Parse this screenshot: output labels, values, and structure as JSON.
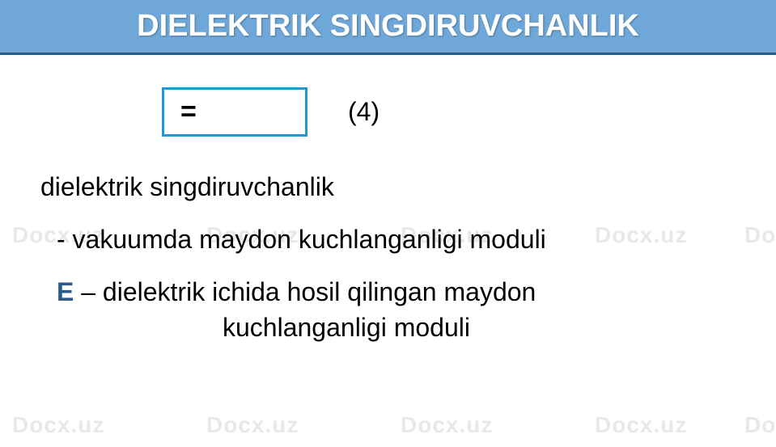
{
  "header": {
    "title": "DIELEKTRIK SINGDIRUVCHANLIK"
  },
  "formula": {
    "expression": "=",
    "label": "(4)"
  },
  "definitions": {
    "line1": "dielektrik singdiruvchanlik",
    "line2_prefix": "- ",
    "line2_text": "vakuumda maydon kuchlanganligi moduli",
    "line3_symbol": "E",
    "line3_separator": " – ",
    "line3_text": "dielektrik ichida hosil qilingan  maydon",
    "line3_continuation": "kuchlanganligi moduli"
  },
  "watermark": {
    "text": "Docx.uz"
  }
}
